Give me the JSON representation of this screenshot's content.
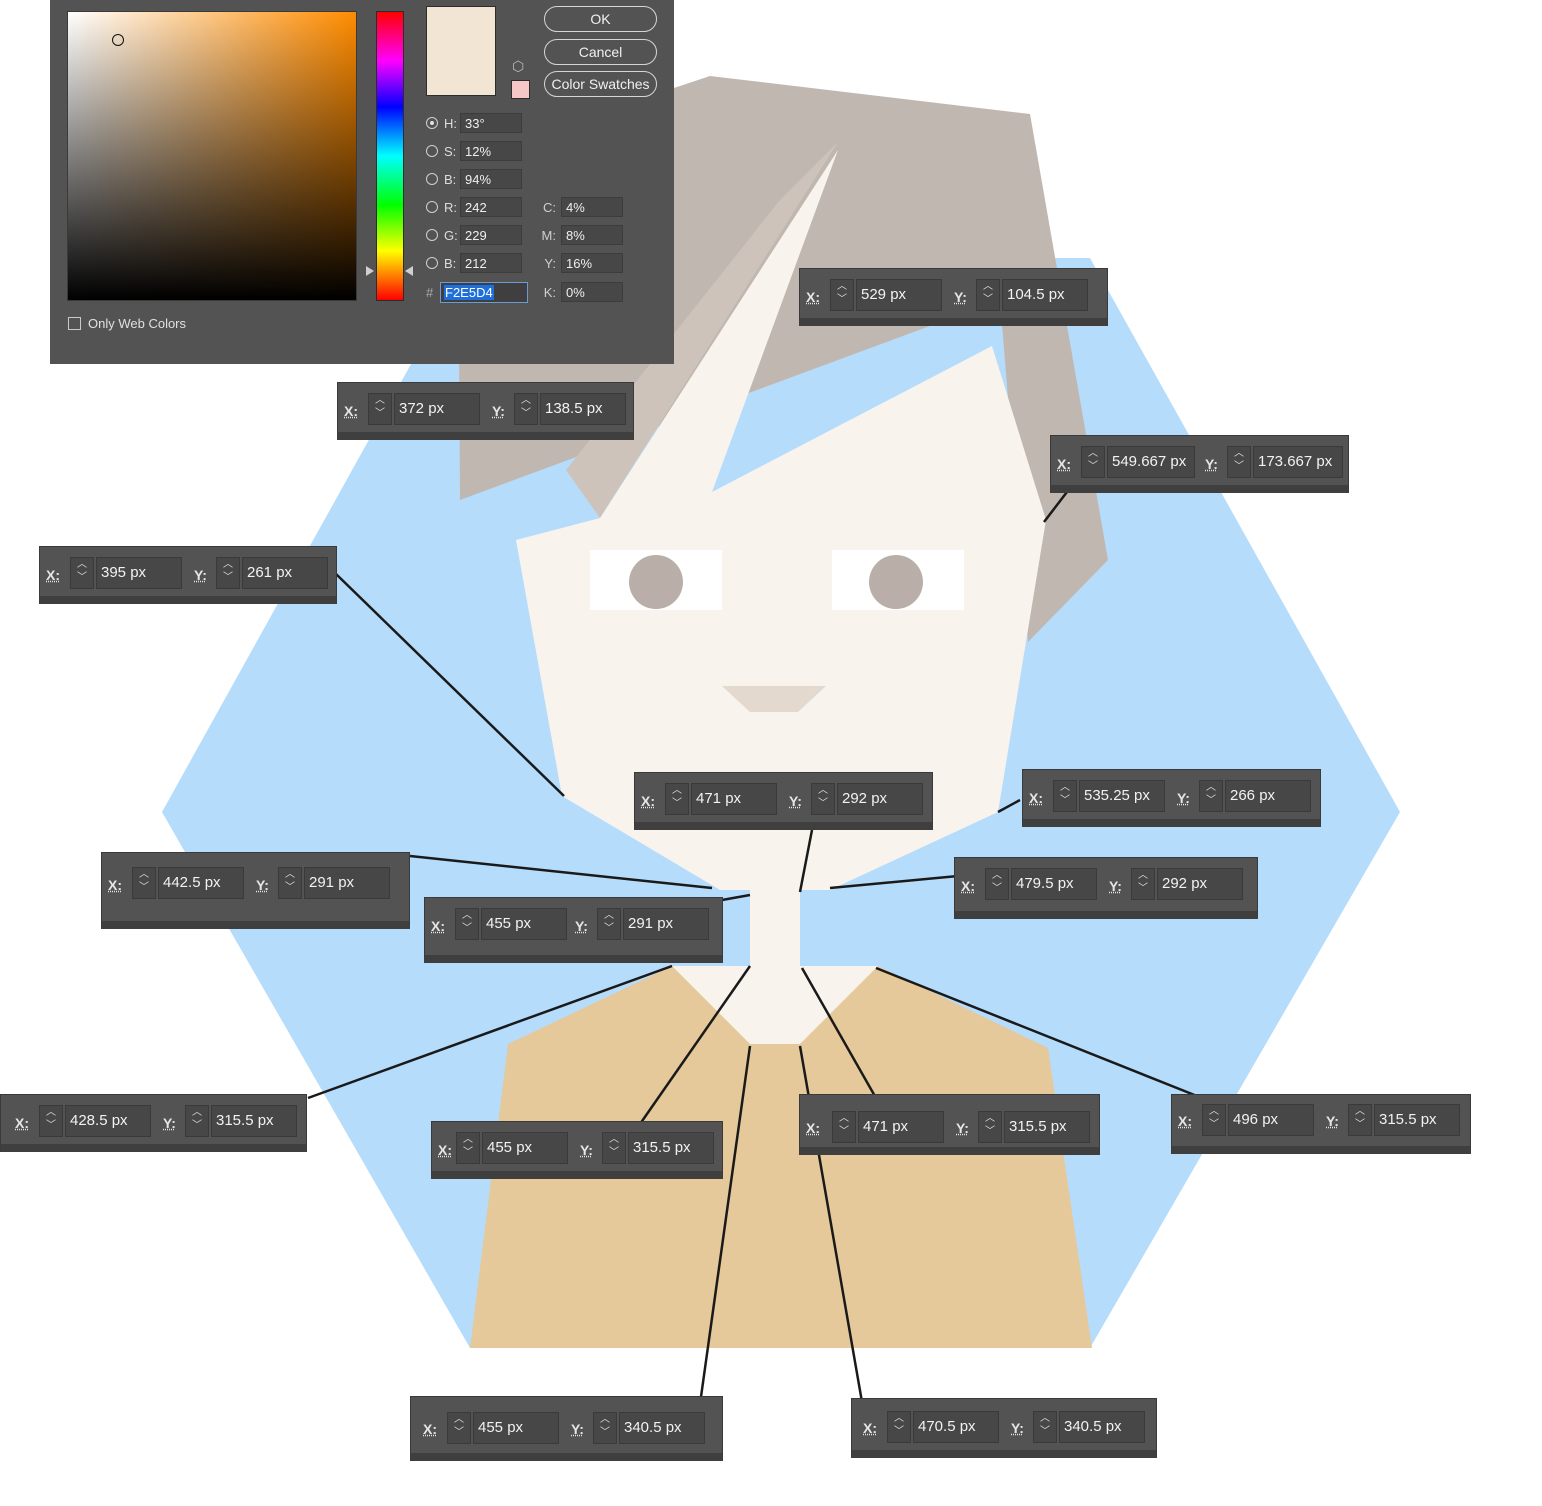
{
  "dialog": {
    "buttons": {
      "ok": "OK",
      "cancel": "Cancel",
      "swatches": "Color Swatches"
    },
    "new_color": "#F2E5D4",
    "current_color": "#F6C7C7",
    "hsb": [
      {
        "label": "H:",
        "value": "33°",
        "selected": true
      },
      {
        "label": "S:",
        "value": "12%"
      },
      {
        "label": "B:",
        "value": "94%"
      }
    ],
    "rgb": [
      {
        "label": "R:",
        "value": "242"
      },
      {
        "label": "G:",
        "value": "229"
      },
      {
        "label": "B:",
        "value": "212"
      }
    ],
    "cmyk": [
      {
        "label": "C:",
        "value": "4%"
      },
      {
        "label": "M:",
        "value": "8%"
      },
      {
        "label": "Y:",
        "value": "16%"
      },
      {
        "label": "K:",
        "value": "0%"
      }
    ],
    "hex_label": "#",
    "hex": "F2E5D4",
    "only_web_colors": "Only Web Colors",
    "icons": {
      "gamut": "cube-icon",
      "stepper": "up-down-stepper-icon"
    }
  },
  "artwork_colors": {
    "background_hexagon": "#B5DCFB",
    "hair": "#C1B7B1",
    "face": "#F8F4ED",
    "shirt": "#E5C99A",
    "eye_white": "#FFFFFF",
    "pupil": "#BAAEA8",
    "nose": "#E3D9CE",
    "leader_line": "#1a1a1a"
  },
  "coords": [
    {
      "x": "529 px",
      "y": "104.5 px"
    },
    {
      "x": "372 px",
      "y": "138.5 px"
    },
    {
      "x": "549.667 px",
      "y": "173.667 px"
    },
    {
      "x": "395 px",
      "y": "261 px"
    },
    {
      "x": "471 px",
      "y": "292 px"
    },
    {
      "x": "535.25 px",
      "y": "266 px"
    },
    {
      "x": "442.5 px",
      "y": "291 px"
    },
    {
      "x": "479.5 px",
      "y": "292 px"
    },
    {
      "x": "455 px",
      "y": "291 px"
    },
    {
      "x": "428.5 px",
      "y": "315.5 px"
    },
    {
      "x": "455 px",
      "y": "315.5 px"
    },
    {
      "x": "471 px",
      "y": "315.5 px"
    },
    {
      "x": "496 px",
      "y": "315.5 px"
    },
    {
      "x": "455 px",
      "y": "340.5 px"
    },
    {
      "x": "470.5 px",
      "y": "340.5 px"
    }
  ],
  "axis_labels": {
    "x": "X:",
    "y": "Y:"
  }
}
